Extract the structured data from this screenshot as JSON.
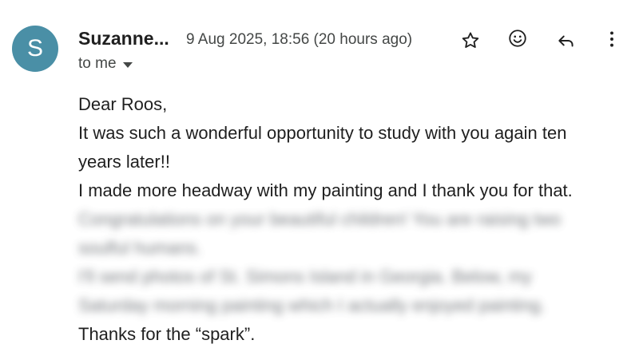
{
  "sender": {
    "name": "Suzanne...",
    "avatar_letter": "S",
    "avatar_color": "#4a8fa6"
  },
  "date": "9 Aug 2025, 18:56 (20 hours ago)",
  "recipient": "to me",
  "icons": [
    "star-icon",
    "emoji-react-icon",
    "reply-icon",
    "more-options-icon"
  ],
  "body": {
    "greeting": "Dear Roos,",
    "line1": "It was such a wonderful opportunity to study with you again ten",
    "line2": "years later!!",
    "line3": "I made more headway with my painting and I thank you for that.",
    "blurred1": "Congratulations on your beautiful children! You are raising two",
    "blurred2": "soulful humans.",
    "blurred3": "I'll send photos of St. Simons Island in Georgia. Below, my",
    "blurred4": "Saturday morning painting which I actually enjoyed painting.",
    "closing": "Thanks for the “spark”."
  }
}
